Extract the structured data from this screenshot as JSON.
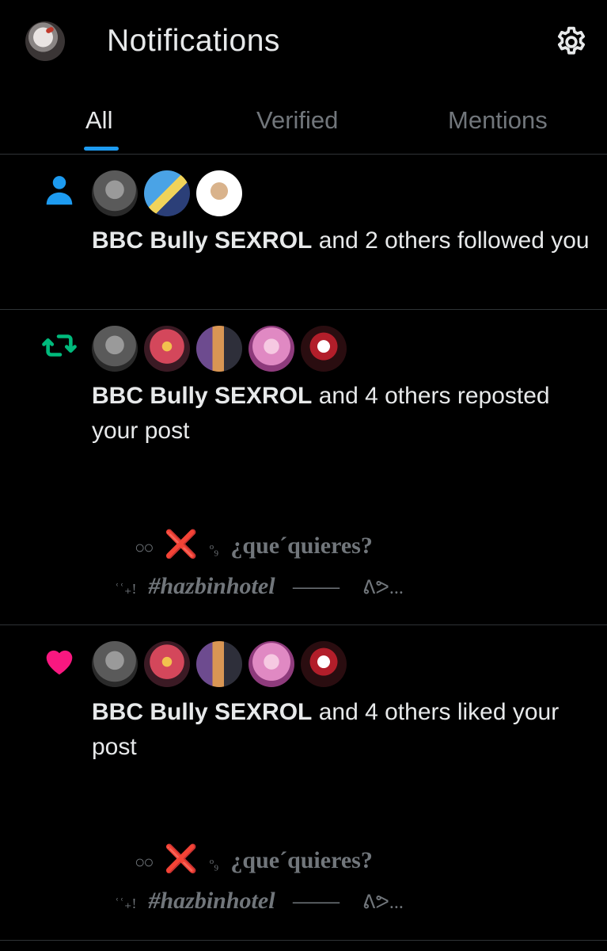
{
  "header": {
    "title": "Notifications",
    "avatar_icon": "profile-avatar",
    "settings_icon": "gear-icon"
  },
  "tabs": [
    {
      "label": "All",
      "active": true
    },
    {
      "label": "Verified",
      "active": false
    },
    {
      "label": "Mentions",
      "active": false
    }
  ],
  "notifications": [
    {
      "type": "follow",
      "icon": "person-icon",
      "icon_color": "#1d9bf0",
      "actor": "BBC Bully SEXROL",
      "rest": " and 2 others followed you"
    },
    {
      "type": "repost",
      "icon": "repost-icon",
      "icon_color": "#00ba7c",
      "actor": "BBC Bully SEXROL",
      "rest": " and 4 others reposted your post",
      "preview": {
        "line1_dots": "○○",
        "line1_x": "❌",
        "line1_glyph": "ᵒ₉",
        "line1_text": "¿que´quieres?",
        "line2_prefix": "ʿʿ₊!",
        "line2_text": "#hazbinhotel",
        "line2_dash": "——",
        "line2_tail": "ᕕᕗ..."
      }
    },
    {
      "type": "like",
      "icon": "heart-icon",
      "icon_color": "#f91880",
      "actor": "BBC Bully SEXROL",
      "rest": " and 4 others liked your post",
      "preview": {
        "line1_dots": "○○",
        "line1_x": "❌",
        "line1_glyph": "ᵒ₉",
        "line1_text": "¿que´quieres?",
        "line2_prefix": "ʿʿ₊!",
        "line2_text": "#hazbinhotel",
        "line2_dash": "——",
        "line2_tail": "ᕕᕗ..."
      }
    }
  ]
}
